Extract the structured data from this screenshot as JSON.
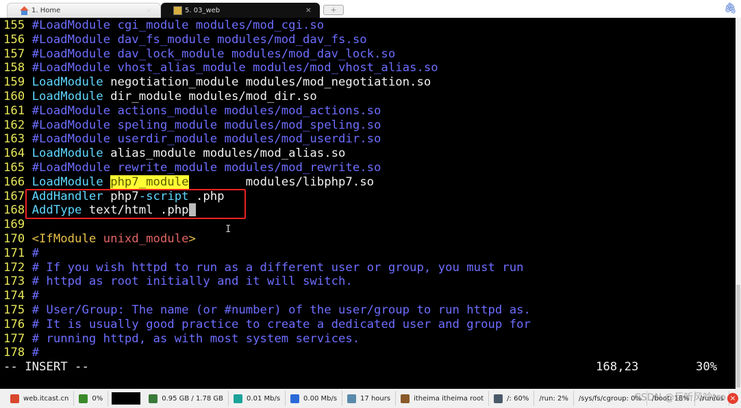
{
  "tabs": [
    {
      "label": "1. Home",
      "icon": "home-icon"
    },
    {
      "label": "5. 03_web",
      "icon": "terminal-icon",
      "active": true
    }
  ],
  "new_tab": "+",
  "editor": {
    "lines": [
      {
        "n": "155",
        "s": [
          [
            "c",
            "#LoadModule cgi_module modules/mod_cgi.so"
          ]
        ]
      },
      {
        "n": "156",
        "s": [
          [
            "c",
            "#LoadModule dav_fs_module modules/mod_dav_fs.so"
          ]
        ]
      },
      {
        "n": "157",
        "s": [
          [
            "c",
            "#LoadModule dav_lock_module modules/mod_dav_lock.so"
          ]
        ]
      },
      {
        "n": "158",
        "s": [
          [
            "c",
            "#LoadModule vhost_alias_module modules/mod_vhost_alias.so"
          ]
        ]
      },
      {
        "n": "159",
        "s": [
          [
            "k",
            "LoadModule"
          ],
          [
            "w",
            " negotiation_module modules/mod_negotiation.so"
          ]
        ]
      },
      {
        "n": "160",
        "s": [
          [
            "k",
            "LoadModule"
          ],
          [
            "w",
            " dir_module modules/mod_dir.so"
          ]
        ]
      },
      {
        "n": "161",
        "s": [
          [
            "c",
            "#LoadModule actions_module modules/mod_actions.so"
          ]
        ]
      },
      {
        "n": "162",
        "s": [
          [
            "c",
            "#LoadModule speling_module modules/mod_speling.so"
          ]
        ]
      },
      {
        "n": "163",
        "s": [
          [
            "c",
            "#LoadModule userdir_module modules/mod_userdir.so"
          ]
        ]
      },
      {
        "n": "164",
        "s": [
          [
            "k",
            "LoadModule"
          ],
          [
            "w",
            " alias_module modules/mod_alias.so"
          ]
        ]
      },
      {
        "n": "165",
        "s": [
          [
            "c",
            "#LoadModule rewrite_module modules/mod_rewrite.so"
          ]
        ]
      },
      {
        "n": "166",
        "s": [
          [
            "k",
            "LoadModule"
          ],
          [
            "w",
            " "
          ],
          [
            "hl",
            "php7_module"
          ],
          [
            "w",
            "        modules/libphp7.so"
          ]
        ]
      },
      {
        "n": "167",
        "s": [
          [
            "k",
            "AddHandler"
          ],
          [
            "w",
            " php7"
          ],
          [
            "k",
            "-script"
          ],
          [
            "w",
            " .php"
          ]
        ]
      },
      {
        "n": "168",
        "s": [
          [
            "k",
            "AddType"
          ],
          [
            "w",
            " text/html .php"
          ]
        ],
        "cursor": true
      },
      {
        "n": "169",
        "s": []
      },
      {
        "n": "170",
        "s": [
          [
            "o",
            "<IfModule "
          ],
          [
            "r",
            "unixd_module"
          ],
          [
            "o",
            ">"
          ]
        ]
      },
      {
        "n": "171",
        "s": [
          [
            "c",
            "#"
          ]
        ]
      },
      {
        "n": "172",
        "s": [
          [
            "c",
            "# If you wish httpd to run as a different user or group, you must run"
          ]
        ]
      },
      {
        "n": "173",
        "s": [
          [
            "c",
            "# httpd as root initially and it will switch."
          ]
        ]
      },
      {
        "n": "174",
        "s": [
          [
            "c",
            "#"
          ]
        ]
      },
      {
        "n": "175",
        "s": [
          [
            "c",
            "# User/Group: The name (or #number) of the user/group to run httpd as."
          ]
        ]
      },
      {
        "n": "176",
        "s": [
          [
            "c",
            "# It is usually good practice to create a dedicated user and group for"
          ]
        ]
      },
      {
        "n": "177",
        "s": [
          [
            "c",
            "# running httpd, as with most system services."
          ]
        ]
      },
      {
        "n": "178",
        "s": [
          [
            "c",
            "#"
          ]
        ]
      }
    ],
    "mode": "-- INSERT --",
    "position": "168,23",
    "percent": "30%"
  },
  "colors": {
    "line_number": "#e6e65a",
    "comment": "#6d6dff",
    "keyword": "#5fd7ff",
    "highlight": "#ffff33",
    "annotation_box": "#ee2222"
  },
  "taskbar": [
    {
      "label": "web.itcast.cn",
      "icon": "server-icon",
      "color": "#d9472b"
    },
    {
      "label": "0%",
      "icon": "cpu-icon",
      "color": "#3a8a2a"
    },
    {
      "label": "",
      "icon": "graph-box"
    },
    {
      "label": "0.95 GB / 1.78 GB",
      "icon": "memory-icon",
      "color": "#3a7a3a"
    },
    {
      "label": "0.01 Mb/s",
      "icon": "upload-icon",
      "color": "#1aa39a"
    },
    {
      "label": "0.00 Mb/s",
      "icon": "download-icon",
      "color": "#2a6ad8"
    },
    {
      "label": "17 hours",
      "icon": "uptime-icon",
      "color": "#5a8aaa"
    },
    {
      "label": "itheima  itheima  root",
      "icon": "user-icon",
      "color": "#8a5a2a"
    },
    {
      "label": "/: 60%",
      "icon": "disk-icon",
      "color": "#4a5a6a"
    },
    {
      "label": "/run: 2%"
    },
    {
      "label": "/sys/fs/cgroup: 0%"
    },
    {
      "label": "/boot: 18%"
    },
    {
      "label": "/run/us"
    }
  ],
  "watermark": "CSDN @巨听风吟tro"
}
